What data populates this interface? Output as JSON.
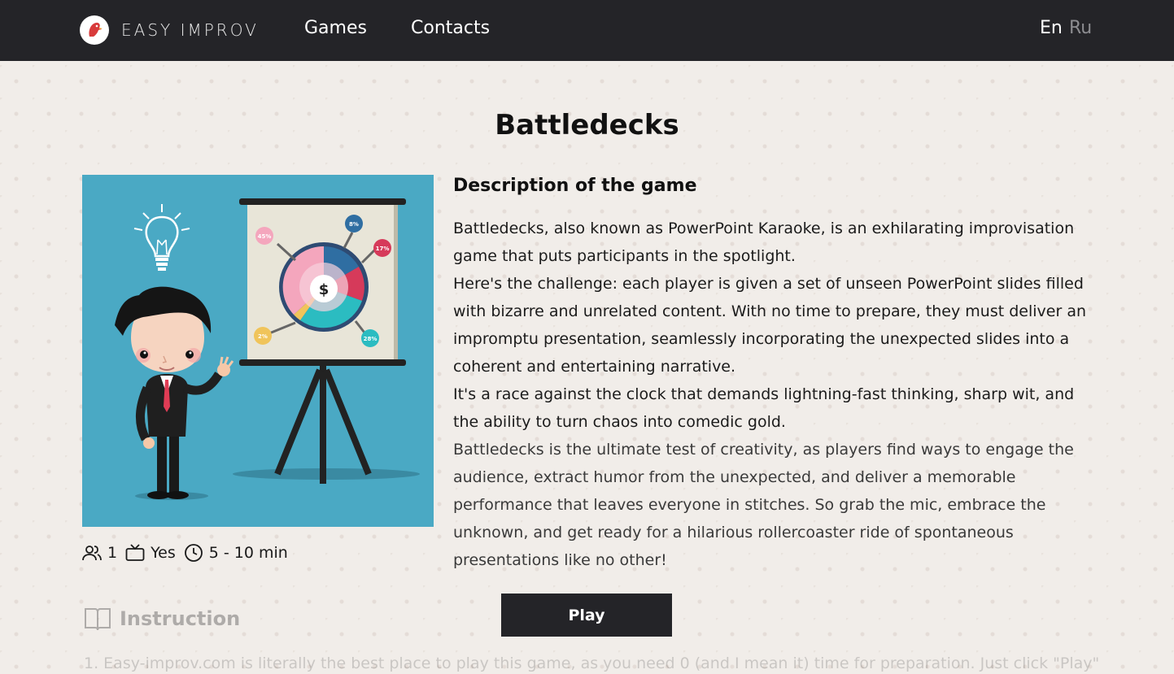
{
  "header": {
    "logo_text": "EASY IMPROV",
    "nav": [
      {
        "label": "Games"
      },
      {
        "label": "Contacts"
      }
    ],
    "languages": {
      "en": "En",
      "ru": "Ru"
    }
  },
  "game": {
    "title": "Battledecks",
    "description_heading": "Description of the game",
    "description": [
      "Battledecks, also known as PowerPoint Karaoke, is an exhilarating improvisation game that puts participants in the spotlight.",
      "Here's the challenge: each player is given a set of unseen PowerPoint slides filled with bizarre and unrelated content. With no time to prepare, they must deliver an impromptu presentation, seamlessly incorporating the unexpected slides into a coherent and entertaining narrative.",
      "It's a race against the clock that demands lightning-fast thinking, sharp wit, and the ability to turn chaos into comedic gold.",
      "Battledecks is the ultimate test of creativity, as players find ways to engage the audience, extract humor from the unexpected, and deliver a memorable performance that leaves everyone in stitches. So grab the mic, embrace the unknown, and get ready for a hilarious rollercoaster ride of spontaneous presentations like no other!"
    ],
    "meta": {
      "players": "1",
      "screen": "Yes",
      "duration": "5 - 10 min"
    },
    "image_labels": {
      "p45": "45%",
      "p8": "8%",
      "p17": "17%",
      "p2": "2%",
      "p28": "28%",
      "currency": "$"
    },
    "play_label": "Play",
    "instruction_heading": "Instruction",
    "instruction_first": "1. Easy-improv.com is literally the best place to play this game, as you need 0 (and I mean it) time for preparation. Just click \"Play\""
  },
  "colors": {
    "header_bg": "#242428",
    "page_bg": "#f1ede9",
    "image_bg": "#4aa9c4",
    "button_bg": "#242428"
  }
}
